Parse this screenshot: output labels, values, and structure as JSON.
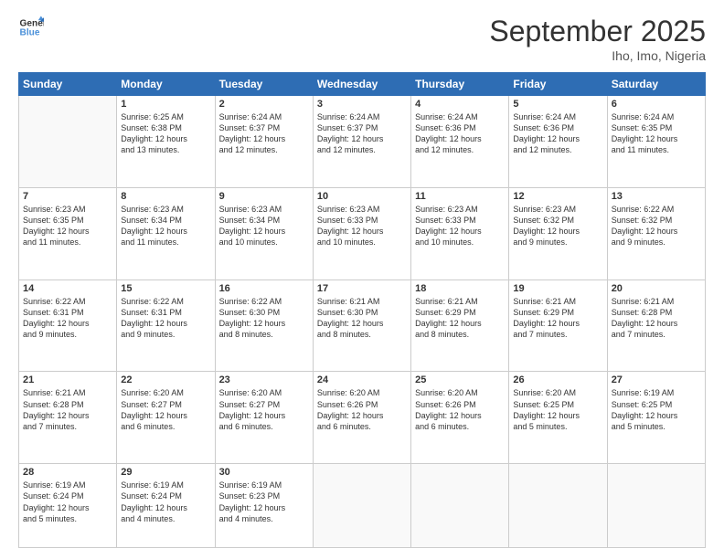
{
  "header": {
    "logo_line1": "General",
    "logo_line2": "Blue",
    "month": "September 2025",
    "location": "Iho, Imo, Nigeria"
  },
  "weekdays": [
    "Sunday",
    "Monday",
    "Tuesday",
    "Wednesday",
    "Thursday",
    "Friday",
    "Saturday"
  ],
  "weeks": [
    [
      {
        "day": "",
        "info": ""
      },
      {
        "day": "1",
        "info": "Sunrise: 6:25 AM\nSunset: 6:38 PM\nDaylight: 12 hours\nand 13 minutes."
      },
      {
        "day": "2",
        "info": "Sunrise: 6:24 AM\nSunset: 6:37 PM\nDaylight: 12 hours\nand 12 minutes."
      },
      {
        "day": "3",
        "info": "Sunrise: 6:24 AM\nSunset: 6:37 PM\nDaylight: 12 hours\nand 12 minutes."
      },
      {
        "day": "4",
        "info": "Sunrise: 6:24 AM\nSunset: 6:36 PM\nDaylight: 12 hours\nand 12 minutes."
      },
      {
        "day": "5",
        "info": "Sunrise: 6:24 AM\nSunset: 6:36 PM\nDaylight: 12 hours\nand 12 minutes."
      },
      {
        "day": "6",
        "info": "Sunrise: 6:24 AM\nSunset: 6:35 PM\nDaylight: 12 hours\nand 11 minutes."
      }
    ],
    [
      {
        "day": "7",
        "info": "Sunrise: 6:23 AM\nSunset: 6:35 PM\nDaylight: 12 hours\nand 11 minutes."
      },
      {
        "day": "8",
        "info": "Sunrise: 6:23 AM\nSunset: 6:34 PM\nDaylight: 12 hours\nand 11 minutes."
      },
      {
        "day": "9",
        "info": "Sunrise: 6:23 AM\nSunset: 6:34 PM\nDaylight: 12 hours\nand 10 minutes."
      },
      {
        "day": "10",
        "info": "Sunrise: 6:23 AM\nSunset: 6:33 PM\nDaylight: 12 hours\nand 10 minutes."
      },
      {
        "day": "11",
        "info": "Sunrise: 6:23 AM\nSunset: 6:33 PM\nDaylight: 12 hours\nand 10 minutes."
      },
      {
        "day": "12",
        "info": "Sunrise: 6:23 AM\nSunset: 6:32 PM\nDaylight: 12 hours\nand 9 minutes."
      },
      {
        "day": "13",
        "info": "Sunrise: 6:22 AM\nSunset: 6:32 PM\nDaylight: 12 hours\nand 9 minutes."
      }
    ],
    [
      {
        "day": "14",
        "info": "Sunrise: 6:22 AM\nSunset: 6:31 PM\nDaylight: 12 hours\nand 9 minutes."
      },
      {
        "day": "15",
        "info": "Sunrise: 6:22 AM\nSunset: 6:31 PM\nDaylight: 12 hours\nand 9 minutes."
      },
      {
        "day": "16",
        "info": "Sunrise: 6:22 AM\nSunset: 6:30 PM\nDaylight: 12 hours\nand 8 minutes."
      },
      {
        "day": "17",
        "info": "Sunrise: 6:21 AM\nSunset: 6:30 PM\nDaylight: 12 hours\nand 8 minutes."
      },
      {
        "day": "18",
        "info": "Sunrise: 6:21 AM\nSunset: 6:29 PM\nDaylight: 12 hours\nand 8 minutes."
      },
      {
        "day": "19",
        "info": "Sunrise: 6:21 AM\nSunset: 6:29 PM\nDaylight: 12 hours\nand 7 minutes."
      },
      {
        "day": "20",
        "info": "Sunrise: 6:21 AM\nSunset: 6:28 PM\nDaylight: 12 hours\nand 7 minutes."
      }
    ],
    [
      {
        "day": "21",
        "info": "Sunrise: 6:21 AM\nSunset: 6:28 PM\nDaylight: 12 hours\nand 7 minutes."
      },
      {
        "day": "22",
        "info": "Sunrise: 6:20 AM\nSunset: 6:27 PM\nDaylight: 12 hours\nand 6 minutes."
      },
      {
        "day": "23",
        "info": "Sunrise: 6:20 AM\nSunset: 6:27 PM\nDaylight: 12 hours\nand 6 minutes."
      },
      {
        "day": "24",
        "info": "Sunrise: 6:20 AM\nSunset: 6:26 PM\nDaylight: 12 hours\nand 6 minutes."
      },
      {
        "day": "25",
        "info": "Sunrise: 6:20 AM\nSunset: 6:26 PM\nDaylight: 12 hours\nand 6 minutes."
      },
      {
        "day": "26",
        "info": "Sunrise: 6:20 AM\nSunset: 6:25 PM\nDaylight: 12 hours\nand 5 minutes."
      },
      {
        "day": "27",
        "info": "Sunrise: 6:19 AM\nSunset: 6:25 PM\nDaylight: 12 hours\nand 5 minutes."
      }
    ],
    [
      {
        "day": "28",
        "info": "Sunrise: 6:19 AM\nSunset: 6:24 PM\nDaylight: 12 hours\nand 5 minutes."
      },
      {
        "day": "29",
        "info": "Sunrise: 6:19 AM\nSunset: 6:24 PM\nDaylight: 12 hours\nand 4 minutes."
      },
      {
        "day": "30",
        "info": "Sunrise: 6:19 AM\nSunset: 6:23 PM\nDaylight: 12 hours\nand 4 minutes."
      },
      {
        "day": "",
        "info": ""
      },
      {
        "day": "",
        "info": ""
      },
      {
        "day": "",
        "info": ""
      },
      {
        "day": "",
        "info": ""
      }
    ]
  ]
}
